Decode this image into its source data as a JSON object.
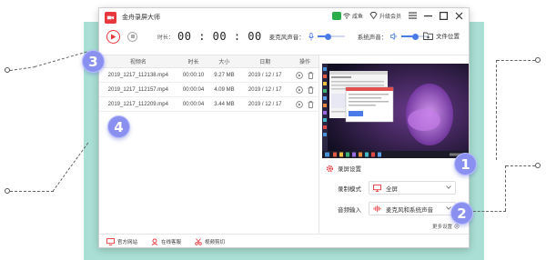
{
  "app": {
    "title": "金舟录屏大师",
    "brand_color": "#e8383d"
  },
  "titlebar": {
    "user_label": "咸鱼",
    "upgrade_label": "升级会员"
  },
  "toolbar": {
    "timer_label": "时长：",
    "timer_value": "00 : 00 : 00",
    "mic_label": "麦克风声音：",
    "mic_level": 0.4,
    "system_label": "系统声音：",
    "system_level": 0.5,
    "file_location_label": "文件位置"
  },
  "table": {
    "headers": [
      "视频名",
      "时长",
      "大小",
      "日期",
      "操作"
    ],
    "rows": [
      {
        "name": "2019_1217_112138.mp4",
        "duration": "00:00:10",
        "size": "9.27 MB",
        "date": "2019 / 12 / 17"
      },
      {
        "name": "2019_1217_112157.mp4",
        "duration": "00:00:04",
        "size": "4.09 MB",
        "date": "2019 / 12 / 17"
      },
      {
        "name": "2019_1217_112209.mp4",
        "duration": "00:00:04",
        "size": "3.44 MB",
        "date": "2019 / 12 / 17"
      }
    ]
  },
  "settings": {
    "header": "录屏设置",
    "mode_label": "录制模式",
    "mode_value": "全屏",
    "audio_label": "音频输入",
    "audio_value": "麦克风和系统声音",
    "more_label": "更多设置"
  },
  "footer": {
    "website": "官方网站",
    "service": "在线客服",
    "editor": "视频剪切"
  },
  "badges": [
    "3",
    "4",
    "1",
    "2"
  ],
  "colors": {
    "accent": "#4b7be8",
    "badge": "#8a90f0",
    "backdrop": "#a9dfd4"
  }
}
